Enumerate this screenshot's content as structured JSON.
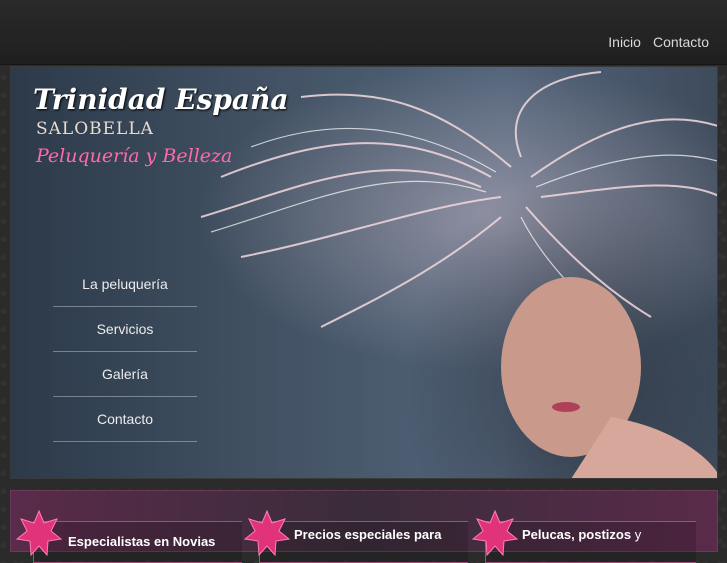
{
  "topnav": {
    "items": [
      "Inicio",
      "Contacto"
    ]
  },
  "brand": {
    "title": "Trinidad España",
    "subtitle": "SALOBELLA",
    "tagline": "Peluquería y Belleza"
  },
  "sidenav": {
    "items": [
      "La peluquería",
      "Servicios",
      "Galería",
      "Contacto"
    ]
  },
  "features": [
    {
      "label": "Especialistas en Novias"
    },
    {
      "label": "Precios especiales para"
    },
    {
      "label": "Pelucas, postizos",
      "suffix": " y"
    }
  ],
  "colors": {
    "accent": "#ff6aa9",
    "star": "#e0337a"
  }
}
